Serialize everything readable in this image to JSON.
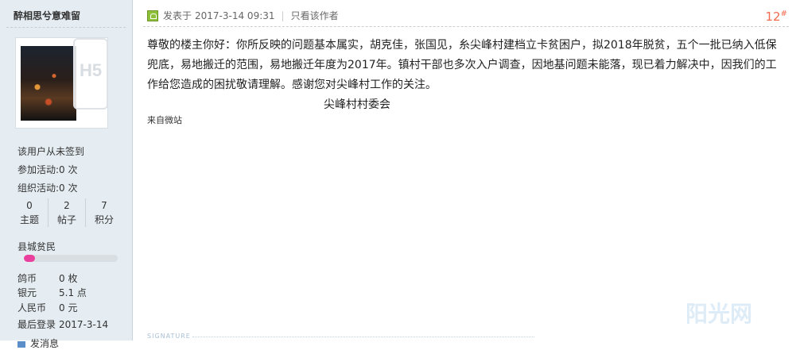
{
  "user": {
    "name": "醉相思兮意难留",
    "avatar_overlay": "H5",
    "info_lines": [
      "该用户从未签到",
      "参加活动:0 次",
      "组织活动:0 次"
    ],
    "stats": [
      {
        "value": "0",
        "label": "主题"
      },
      {
        "value": "2",
        "label": "帖子"
      },
      {
        "value": "7",
        "label": "积分"
      }
    ],
    "level": "县城贫民",
    "level_progress": 0.12,
    "level_color": "#ea3f9c",
    "fields": [
      {
        "key": "鸽币",
        "value": "0 枚"
      },
      {
        "key": "银元",
        "value": "5.1 点"
      },
      {
        "key": "人民币",
        "value": "0 元"
      },
      {
        "key": "最后登录",
        "value": "2017-3-14"
      }
    ],
    "pm_label": "发消息"
  },
  "post": {
    "posted_prefix": "发表于",
    "posted_time": "2017-3-14 09:31",
    "author_only": "只看该作者",
    "floor": "12",
    "floor_mark": "#",
    "paragraph": "尊敬的楼主你好：你所反映的问题基本属实，胡克佳，张国见，糸尖峰村建档立卡贫困户，拟2018年脱贫，五个一批已纳入低保兜底，易地搬迁的范围，易地搬迁年度为2017年。镇村干部也多次入户调查，因地基问题未能落，现已着力解决中，因我们的工作给您造成的困扰敬请理解。感谢您对尖峰村工作的关注。",
    "sign_off": "尖峰村村委会",
    "source": "来自微站",
    "signature_label": "SIGNATURE"
  },
  "watermark": "阳光网",
  "colors": {
    "sidebar_bg": "#e5edf2",
    "floor_number": "#f26c4f",
    "post_icon": "#8ebf3a"
  },
  "icons": {
    "post_icon": "post-status-icon",
    "pm_icon": "message-icon"
  }
}
